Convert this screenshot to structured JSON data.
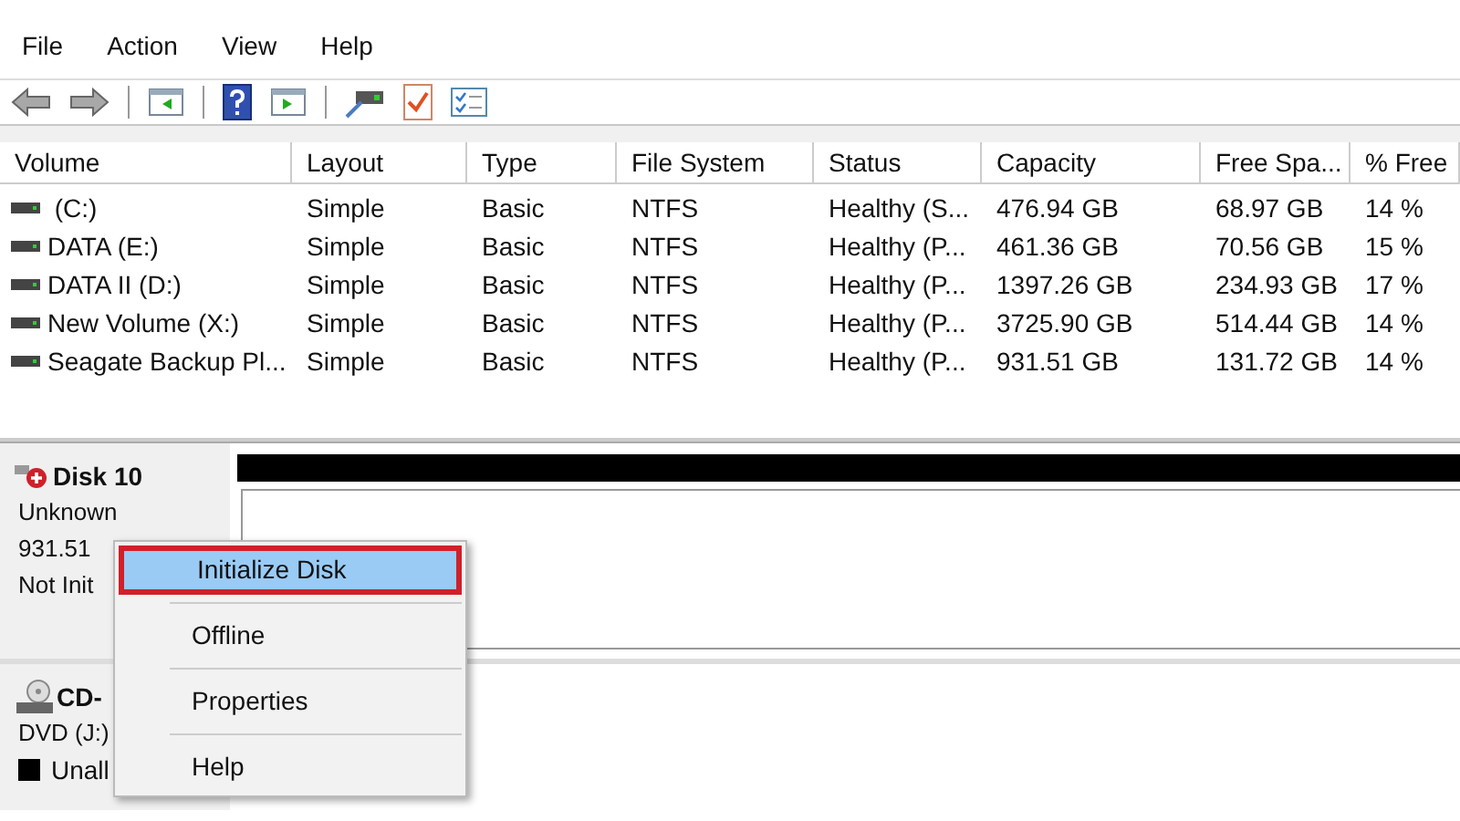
{
  "menu_bar": [
    "File",
    "Action",
    "View",
    "Help"
  ],
  "toolbar": [
    {
      "kind": "back"
    },
    {
      "kind": "forward"
    },
    {
      "kind": "sep"
    },
    {
      "kind": "console"
    },
    {
      "kind": "sep"
    },
    {
      "kind": "help"
    },
    {
      "kind": "action"
    },
    {
      "kind": "sep"
    },
    {
      "kind": "connect"
    },
    {
      "kind": "check"
    },
    {
      "kind": "list"
    }
  ],
  "table": {
    "columns": [
      "Volume",
      "Layout",
      "Type",
      "File System",
      "Status",
      "Capacity",
      "Free Spa...",
      "% Free"
    ],
    "rows": [
      {
        "cells": [
          " (C:)",
          "Simple",
          "Basic",
          "NTFS",
          "Healthy (S...",
          "476.94 GB",
          "68.97 GB",
          "14 %"
        ]
      },
      {
        "cells": [
          "DATA (E:)",
          "Simple",
          "Basic",
          "NTFS",
          "Healthy (P...",
          "461.36 GB",
          "70.56 GB",
          "15 %"
        ]
      },
      {
        "cells": [
          "DATA II (D:)",
          "Simple",
          "Basic",
          "NTFS",
          "Healthy (P...",
          "1397.26 GB",
          "234.93 GB",
          "17 %"
        ]
      },
      {
        "cells": [
          "New Volume (X:)",
          "Simple",
          "Basic",
          "NTFS",
          "Healthy (P...",
          "3725.90 GB",
          "514.44 GB",
          "14 %"
        ]
      },
      {
        "cells": [
          "Seagate Backup Pl...",
          "Simple",
          "Basic",
          "NTFS",
          "Healthy (P...",
          "931.51 GB",
          "131.72 GB",
          "14 %"
        ]
      }
    ]
  },
  "disks": [
    {
      "kind": "hdd",
      "name": "Disk 10",
      "lines": [
        "Unknown",
        "931.51",
        "Not Init"
      ]
    },
    {
      "kind": "cd",
      "name": "CD-",
      "lines": [
        "DVD (J:)"
      ]
    }
  ],
  "legend": [
    {
      "label": "Unall",
      "color": "#000000"
    }
  ],
  "context_menu": {
    "items": [
      {
        "label": "Initialize Disk",
        "selected": true,
        "annotated": true
      },
      {
        "label": "Offline",
        "selected": false,
        "annotated": false
      },
      {
        "label": "Properties",
        "selected": false,
        "annotated": false
      },
      {
        "label": "Help",
        "selected": false,
        "annotated": false
      }
    ]
  }
}
